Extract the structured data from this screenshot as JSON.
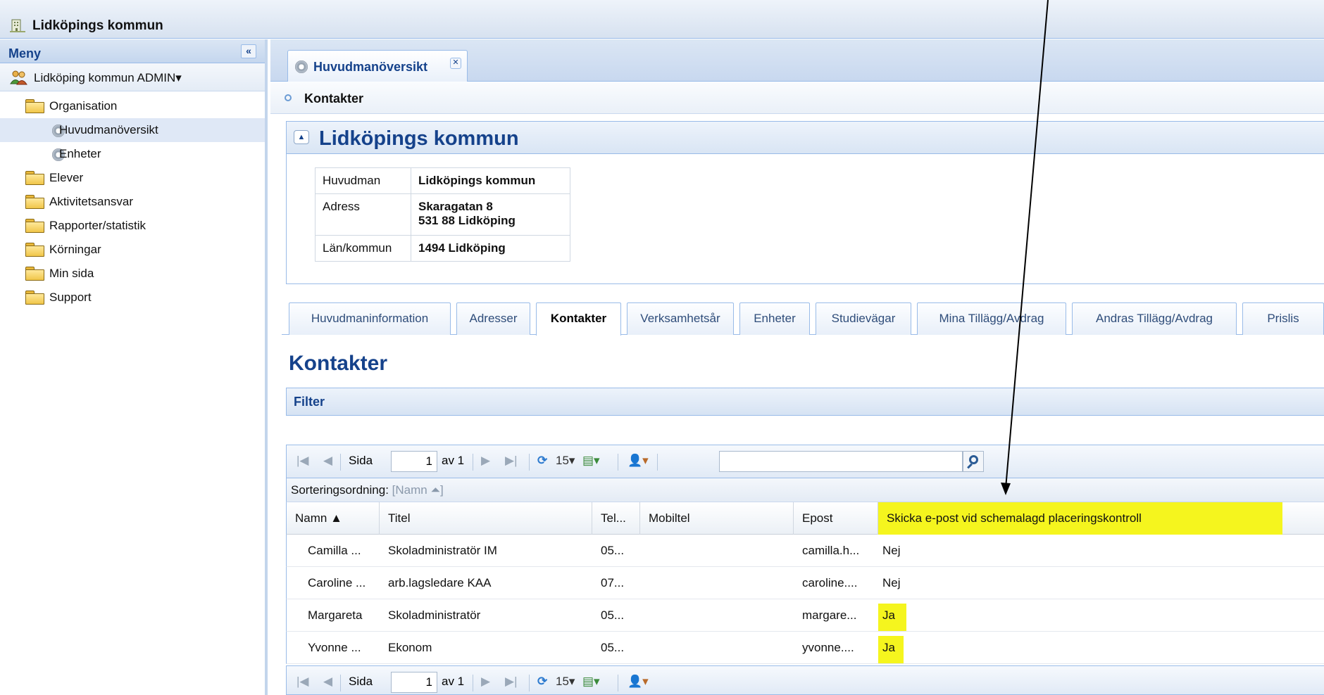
{
  "app": {
    "title": "Lidköpings kommun"
  },
  "menu": {
    "header": "Meny",
    "collapse_symbol": "«",
    "org_selector": "Lidköping kommun ADMIN▾",
    "items": [
      {
        "label": "Organisation",
        "type": "folder-open"
      },
      {
        "label": "Huvudmanöversikt",
        "type": "page",
        "selected": true
      },
      {
        "label": "Enheter",
        "type": "page"
      },
      {
        "label": "Elever",
        "type": "folder"
      },
      {
        "label": "Aktivitetsansvar",
        "type": "folder"
      },
      {
        "label": "Rapporter/statistik",
        "type": "folder"
      },
      {
        "label": "Körningar",
        "type": "folder"
      },
      {
        "label": "Min sida",
        "type": "folder"
      },
      {
        "label": "Support",
        "type": "folder"
      }
    ]
  },
  "doc_tab": {
    "label": "Huvudmanöversikt",
    "close_symbol": "✕"
  },
  "breadcrumb": "Kontakter",
  "org_panel": {
    "title": "Lidköpings kommun",
    "rows": [
      {
        "key": "Huvudman",
        "value": "Lidköpings kommun"
      },
      {
        "key": "Adress",
        "value": "Skaragatan 8",
        "value2": "531 88 Lidköping"
      },
      {
        "key": "Län/kommun",
        "value": "1494 Lidköping"
      }
    ]
  },
  "tabs": [
    "Huvudmaninformation",
    "Adresser",
    "Kontakter",
    "Verksamhetsår",
    "Enheter",
    "Studievägar",
    "Mina Tillägg/Avdrag",
    "Andras Tillägg/Avdrag",
    "Prislis"
  ],
  "active_tab": "Kontakter",
  "section_title": "Kontakter",
  "filter_label": "Filter",
  "pager": {
    "page_label": "Sida",
    "page_value": "1",
    "of_label": "av 1",
    "page_size": "15▾"
  },
  "sort": {
    "label": "Sorteringsordning:",
    "value": "[Namn ⏶]"
  },
  "grid": {
    "columns": [
      "Namn ▲",
      "Titel",
      "Tel...",
      "Mobiltel",
      "Epost",
      "Skicka e-post vid schemalagd placeringskontroll"
    ],
    "rows": [
      [
        "Camilla ...",
        "Skoladministratör IM",
        "05...",
        "",
        "camilla.h...",
        "Nej"
      ],
      [
        "Caroline ...",
        "arb.lagsledare KAA",
        "07...",
        "",
        "caroline....",
        "Nej"
      ],
      [
        "Margareta",
        "Skoladministratör",
        "05...",
        "",
        "margare...",
        "Ja"
      ],
      [
        "Yvonne ...",
        "Ekonom",
        "05...",
        "",
        "yvonne....",
        "Ja"
      ]
    ]
  },
  "colors": {
    "highlight": "#f5f51e",
    "accent": "#15428b",
    "border": "#99bbe8"
  }
}
